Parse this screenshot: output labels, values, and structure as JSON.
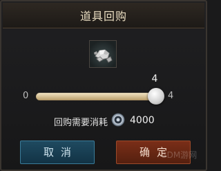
{
  "dialog": {
    "title": "道具回购"
  },
  "item": {
    "icon": "silver-ore-icon"
  },
  "quantity": {
    "current": "4",
    "min": "0",
    "max": "4",
    "fraction": 1.0
  },
  "cost": {
    "label": "回购需要消耗",
    "currency_icon": "silver-coin-icon",
    "amount": "4000"
  },
  "buttons": {
    "cancel": "取消",
    "confirm": "确定"
  },
  "watermark": "3DM游网",
  "colors": {
    "cancel_button": "#1a4257",
    "confirm_button": "#6a2614",
    "title_text": "#e8dcc0"
  }
}
